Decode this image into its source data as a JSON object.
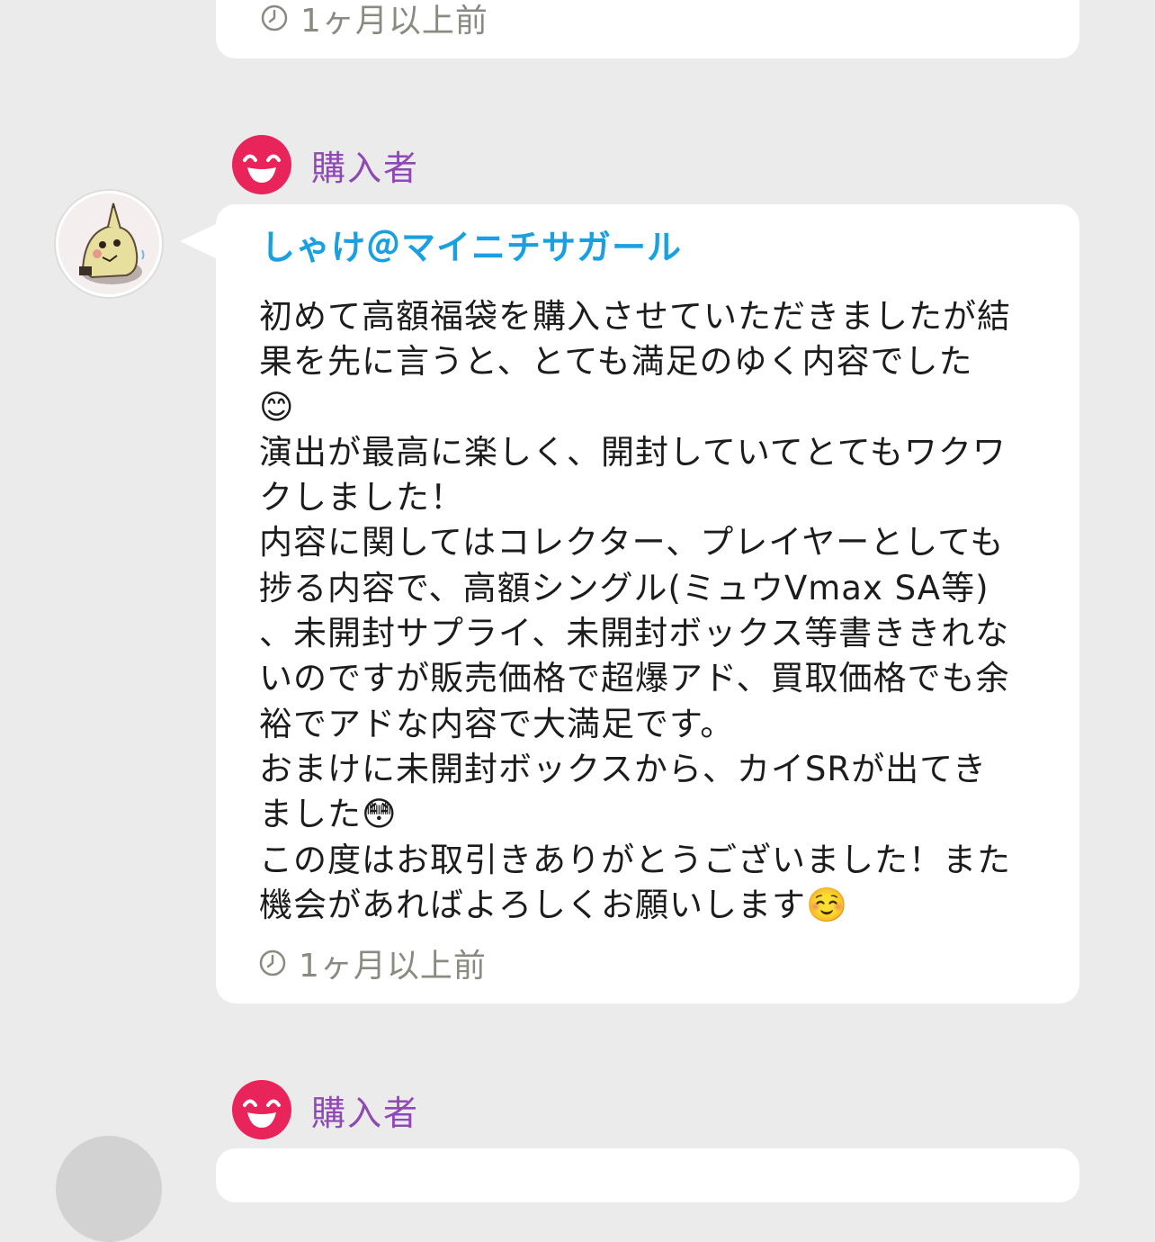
{
  "previous_review": {
    "time": "1ヶ月以上前"
  },
  "review": {
    "rating_label": "購入者",
    "username": "しゃけ＠マイニチサガール",
    "body": "初めて高額福袋を購入させていただきましたが結\n果を先に言うと、とても満足のゆく内容でした\n😊\n演出が最高に楽しく、開封していてとてもワクワ\nクしました！\n内容に関してはコレクター、プレイヤーとしても\n捗る内容で、高額シングル(ミュウVmax SA等)\n、未開封サプライ、未開封ボックス等書ききれな\nいのですが販売価格で超爆アド、買取価格でも余\n裕でアドな内容で大満足です。\nおまけに未開封ボックスから、カイSRが出てき\nました😳\nこの度はお取引きありがとうございました！また\n機会があればよろしくお願いします☺️",
    "time": "1ヶ月以上前"
  },
  "next_review": {
    "rating_label": "購入者"
  },
  "colors": {
    "background": "#ebebeb",
    "username": "#1aa0e0",
    "rating_label": "#8f49b5",
    "face": "#e8245a",
    "timestamp": "#8a8a80"
  },
  "icons": {
    "clock": "clock-icon",
    "rating": "smiling-face-icon",
    "avatar": "user-avatar"
  }
}
